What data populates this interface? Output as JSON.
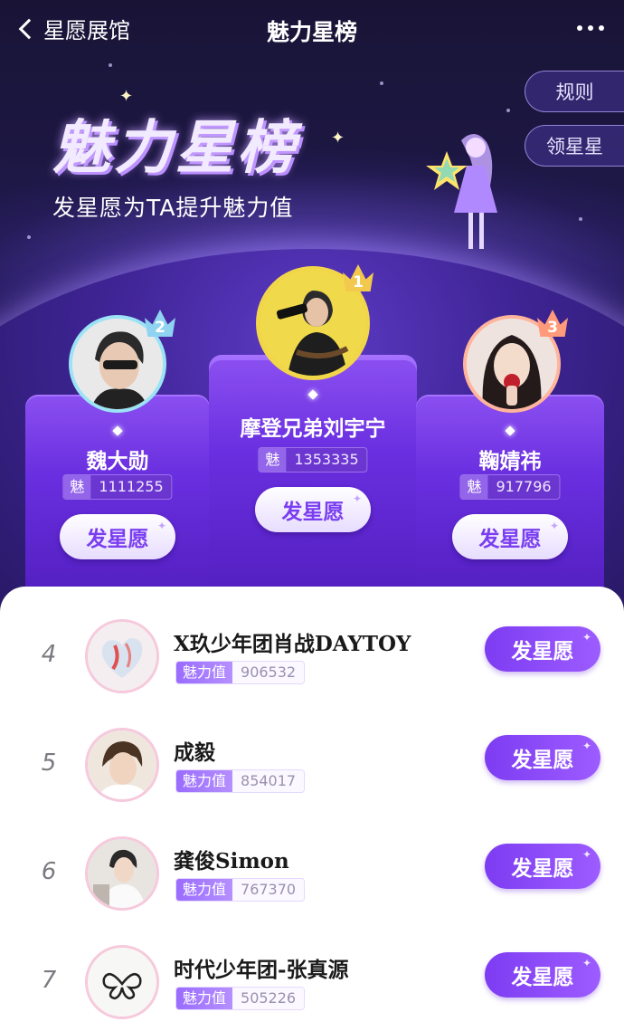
{
  "nav": {
    "back_label": "星愿展馆",
    "title": "魅力星榜",
    "more_icon": "more-dots-icon"
  },
  "side_buttons": {
    "rules": "规则",
    "collect_star": "领星星"
  },
  "hero": {
    "big_title": "魅力星榜",
    "subtitle": "发星愿为TA提升魅力值"
  },
  "score_label": "魅力值",
  "wish_button_label": "发星愿",
  "colors": {
    "accent": "#8a4ff0",
    "gold_badge": "#f2c94c",
    "silver_badge": "#8fd3f0",
    "bronze_badge": "#ff9b7a"
  },
  "podium": [
    {
      "rank": "2",
      "name": "魏大勋",
      "score": "1111255"
    },
    {
      "rank": "1",
      "name": "摩登兄弟刘宇宁",
      "score": "1353335"
    },
    {
      "rank": "3",
      "name": "鞠婧祎",
      "score": "917796"
    }
  ],
  "list": [
    {
      "rank": "4",
      "name": "X玖少年团肖战DAYTOY",
      "score": "906532"
    },
    {
      "rank": "5",
      "name": "成毅",
      "score": "854017"
    },
    {
      "rank": "6",
      "name": "龚俊Simon",
      "score": "767370"
    },
    {
      "rank": "7",
      "name": "时代少年团-张真源",
      "score": "505226"
    }
  ]
}
